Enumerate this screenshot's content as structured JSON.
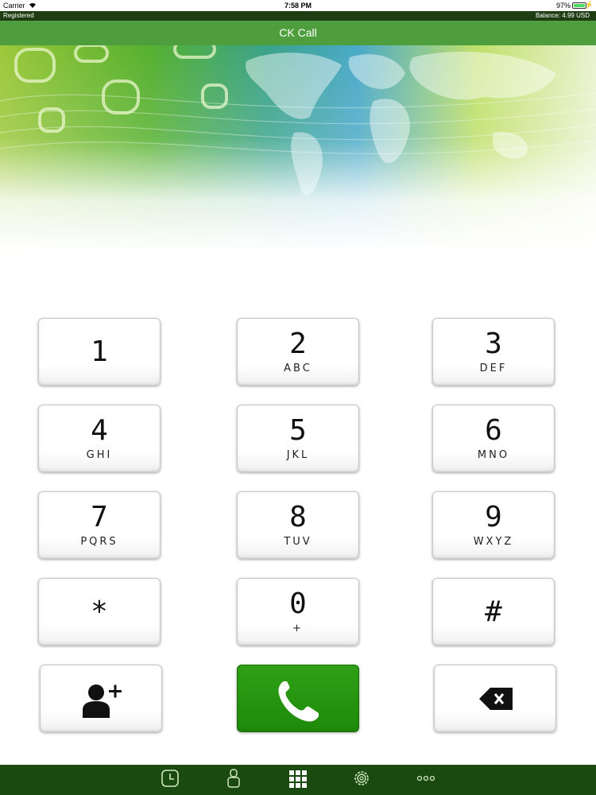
{
  "status_bar": {
    "carrier": "Carrier",
    "time": "7:58 PM",
    "battery": "97%"
  },
  "registration": {
    "status": "Registered",
    "balance": "Balance: 4.99 USD"
  },
  "nav": {
    "title": "CK Call"
  },
  "keypad": {
    "keys": [
      {
        "digit": "1",
        "letters": ""
      },
      {
        "digit": "2",
        "letters": "ABC"
      },
      {
        "digit": "3",
        "letters": "DEF"
      },
      {
        "digit": "4",
        "letters": "GHI"
      },
      {
        "digit": "5",
        "letters": "JKL"
      },
      {
        "digit": "6",
        "letters": "MNO"
      },
      {
        "digit": "7",
        "letters": "PQRS"
      },
      {
        "digit": "8",
        "letters": "TUV"
      },
      {
        "digit": "9",
        "letters": "WXYZ"
      },
      {
        "digit": "*",
        "letters": ""
      },
      {
        "digit": "0",
        "letters": "+"
      },
      {
        "digit": "#",
        "letters": ""
      }
    ],
    "actions": {
      "add_contact_icon": "add-contact-icon",
      "call_icon": "phone-icon",
      "backspace_icon": "backspace-icon"
    }
  },
  "tab_bar": {
    "tabs": [
      {
        "name": "recents",
        "icon": "clock-icon"
      },
      {
        "name": "contacts",
        "icon": "person-icon"
      },
      {
        "name": "keypad",
        "icon": "keypad-grid-icon"
      },
      {
        "name": "settings",
        "icon": "gear-icon"
      },
      {
        "name": "more",
        "icon": "more-dots-icon"
      }
    ]
  },
  "colors": {
    "nav_green": "#4e9e3e",
    "strip_dark": "#1f3d12",
    "tab_bar": "#1a4a10",
    "call_green": "#1f8a0a"
  }
}
